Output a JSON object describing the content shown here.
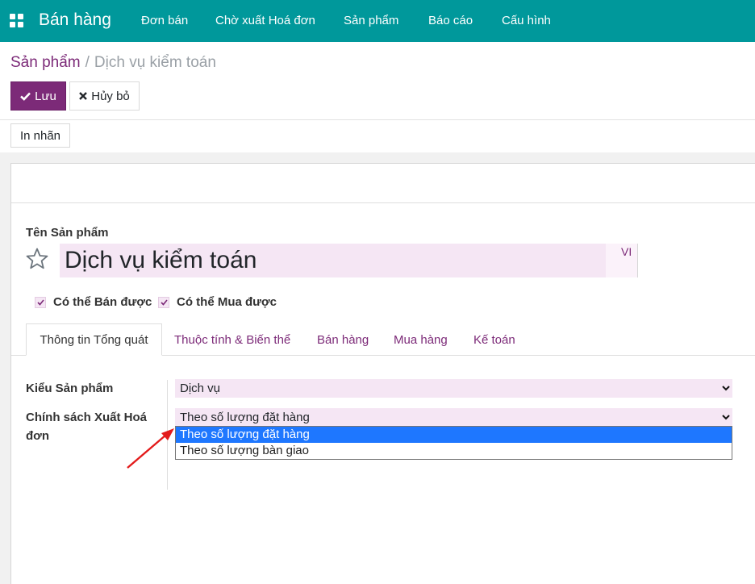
{
  "navbar": {
    "brand": "Bán hàng",
    "items": [
      "Đơn bán",
      "Chờ xuất Hoá đơn",
      "Sản phẩm",
      "Báo cáo",
      "Cấu hình"
    ]
  },
  "breadcrumb": {
    "parent": "Sản phẩm",
    "separator": "/",
    "current": "Dịch vụ kiểm toán"
  },
  "toolbar": {
    "save_label": "Lưu",
    "discard_label": "Hủy bỏ",
    "print_label": "In nhãn"
  },
  "form": {
    "name_label": "Tên Sản phẩm",
    "name_value": "Dịch vụ kiểm toán",
    "lang": "VI",
    "can_be_sold": "Có thể Bán được",
    "can_be_purchased": "Có thể Mua được",
    "tabs": [
      "Thông tin Tổng quát",
      "Thuộc tính & Biến thể",
      "Bán hàng",
      "Mua hàng",
      "Kế toán"
    ],
    "product_type_label": "Kiểu Sản phẩm",
    "product_type_value": "Dịch vụ",
    "invoice_policy_label": "Chính sách Xuất Hoá đơn",
    "invoice_policy_value": "Theo số lượng đặt hàng",
    "invoice_policy_options": [
      "Theo số lượng đặt hàng",
      "Theo số lượng bàn giao"
    ]
  },
  "colors": {
    "navbar": "#00989b",
    "brand_purple": "#7c2a78",
    "field_bg": "#f5e6f4",
    "option_selected": "#1e77ff",
    "annotation_arrow": "#e31b1b"
  }
}
